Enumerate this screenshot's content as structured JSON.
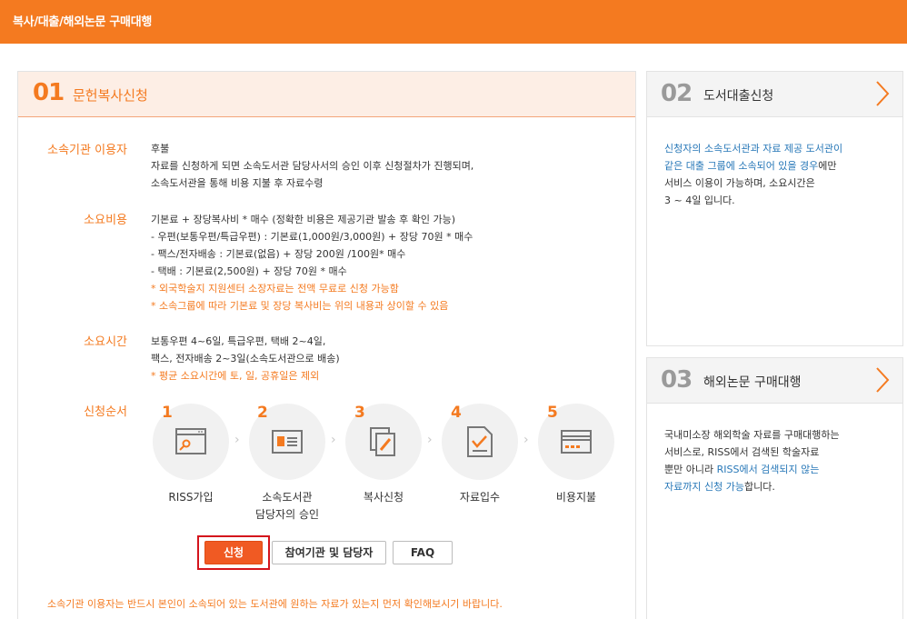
{
  "header": {
    "title": "복사/대출/해외논문 구매대행"
  },
  "copy_panel": {
    "number": "01",
    "title": "문헌복사신청",
    "rows": [
      {
        "label": "소속기관 이용자",
        "lines": [
          "후불",
          "자료를 신청하게 되면 소속도서관 담당사서의 승인 이후 신청절차가 진행되며,",
          "소속도서관을 통해 비용 지불 후 자료수령"
        ]
      },
      {
        "label": "소요비용",
        "lines": [
          "기본료 + 장당복사비 * 매수 (정확한 비용은 제공기관 발송 후 확인 가능)",
          "- 우편(보통우편/특급우편) : 기본료(1,000원/3,000원) + 장당 70원 * 매수",
          "- 팩스/전자배송 : 기본료(없음) + 장당 200원 /100원* 매수",
          "- 택배 : 기본료(2,500원) + 장당 70원 * 매수"
        ],
        "notes": [
          "* 외국학술지 지원센터 소장자료는 전액 무료로 신청 가능함",
          "* 소속그룹에 따라 기본료 및 장당 복사비는 위의 내용과 상이할 수 있음"
        ]
      },
      {
        "label": "소요시간",
        "lines": [
          "보통우편 4~6일, 특급우편, 택배 2~4일,",
          "팩스, 전자배송 2~3일(소속도서관으로 배송)"
        ],
        "notes": [
          "* 평균 소요시간에 토, 일, 공휴일은 제외"
        ]
      }
    ],
    "steps_label": "신청순서",
    "steps": [
      {
        "num": "1",
        "icon": "key-window-icon",
        "label": "RISS가입",
        "label2": ""
      },
      {
        "num": "2",
        "icon": "id-card-icon",
        "label": "소속도서관",
        "label2": "담당자의 승인"
      },
      {
        "num": "3",
        "icon": "copy-document-icon",
        "label": "복사신청",
        "label2": ""
      },
      {
        "num": "4",
        "icon": "checked-document-icon",
        "label": "자료입수",
        "label2": ""
      },
      {
        "num": "5",
        "icon": "payment-card-icon",
        "label": "비용지불",
        "label2": ""
      }
    ],
    "buttons": {
      "apply": "신청",
      "institutions": "참여기관 및 담당자",
      "faq": "FAQ"
    },
    "bottom_note": "소속기관 이용자는 반드시 본인이 소속되어 있는 도서관에 원하는 자료가 있는지 먼저 확인해보시기 바랍니다."
  },
  "loan_panel": {
    "number": "02",
    "title": "도서대출신청",
    "body": {
      "l1_blue": "신청자의 소속도서관과 자료 제공 도서관이",
      "l2_blue": "같은 대출 그룹에 소속되어 있을 경우",
      "l2_rest": "에만",
      "l3": "서비스 이용이 가능하며, 소요시간은",
      "l4": "3 ~ 4일 입니다."
    }
  },
  "purchase_panel": {
    "number": "03",
    "title": "해외논문 구매대행",
    "body": {
      "l1": "국내미소장 해외학술 자료를 구매대행하는",
      "l2": "서비스로, RISS에서 검색된 학술자료",
      "l3_a": "뿐만 아니라 ",
      "l3_blue": "RISS에서 검색되지 않는",
      "l4_blue": "자료까지 신청 가능",
      "l4_rest": "합니다."
    }
  },
  "colors": {
    "accent": "#f47a20",
    "apply_button": "#f05a23",
    "highlight": "#d4141c",
    "link_blue": "#2878b8"
  }
}
